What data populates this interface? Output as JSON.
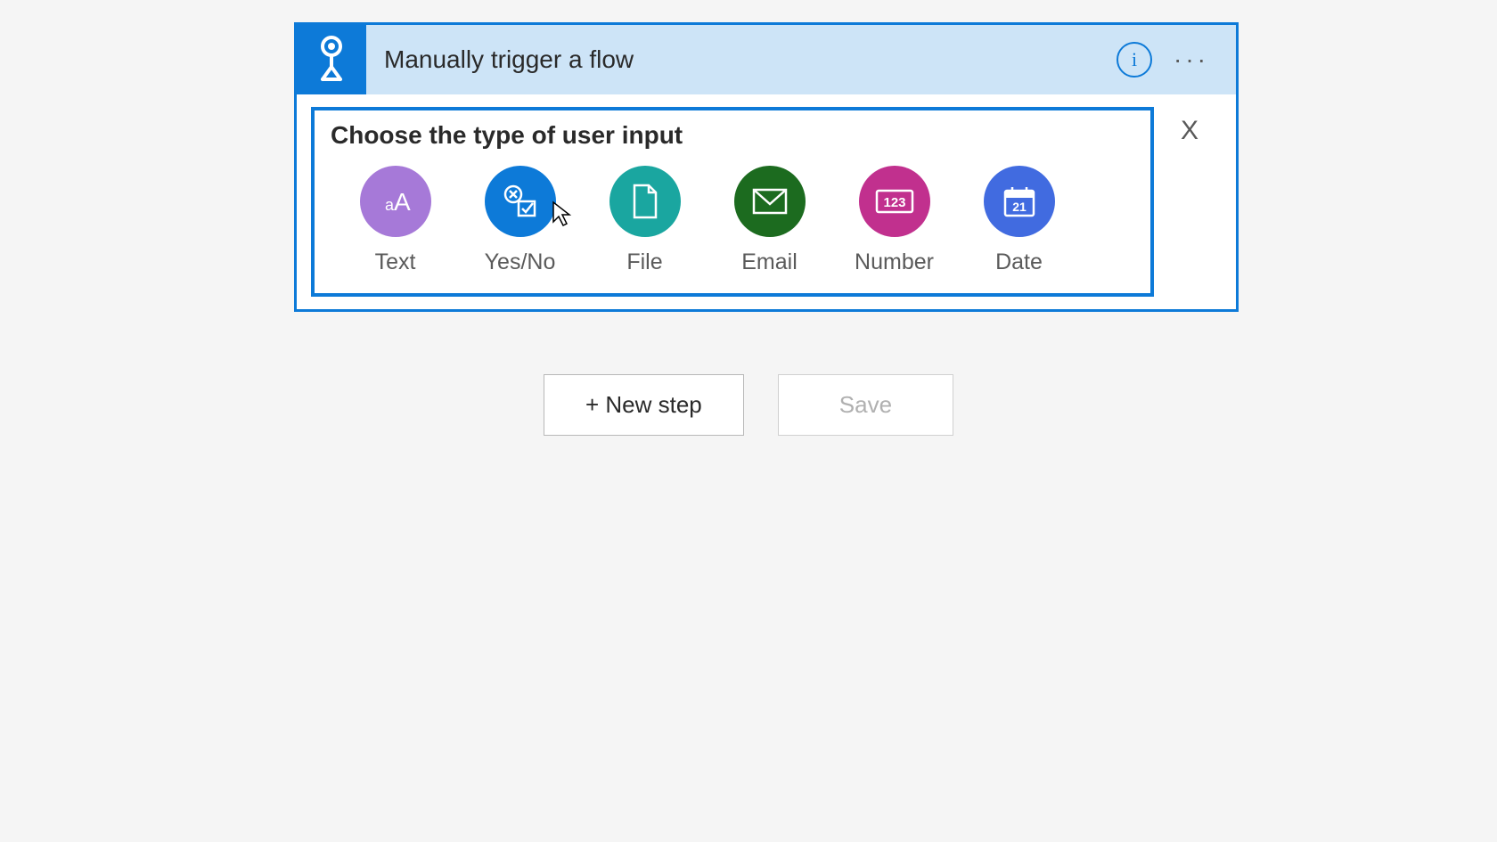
{
  "trigger": {
    "title": "Manually trigger a flow"
  },
  "panel": {
    "heading": "Choose the type of user input",
    "close": "X",
    "types": [
      {
        "label": "Text"
      },
      {
        "label": "Yes/No"
      },
      {
        "label": "File"
      },
      {
        "label": "Email"
      },
      {
        "label": "Number"
      },
      {
        "label": "Date"
      }
    ]
  },
  "actions": {
    "new_step": "+ New step",
    "save": "Save"
  }
}
